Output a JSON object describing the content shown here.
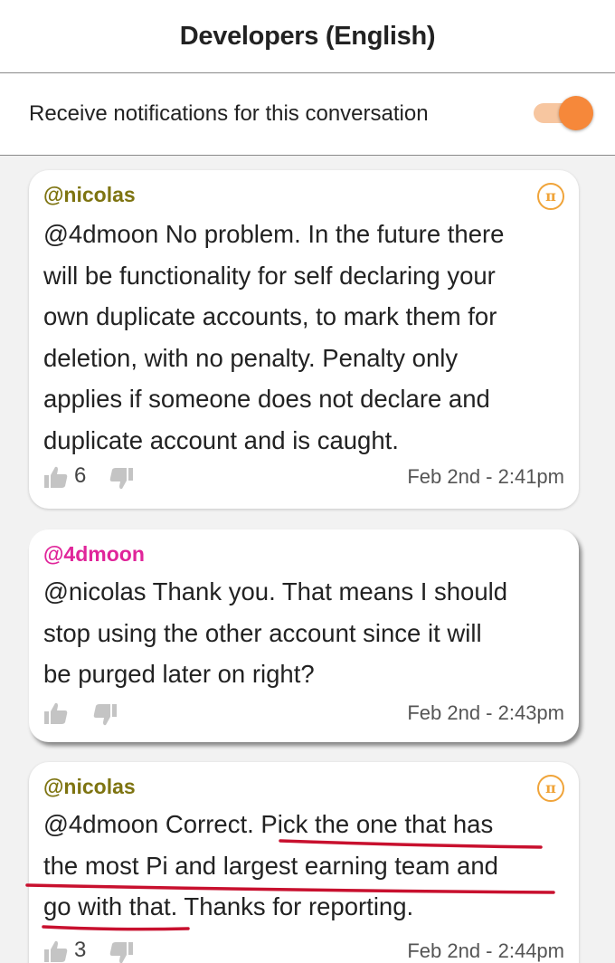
{
  "header": {
    "title": "Developers (English)"
  },
  "notifications": {
    "label": "Receive notifications for this conversation",
    "enabled": true,
    "accent": "#f6883a"
  },
  "messages": [
    {
      "author": "@nicolas",
      "badge": "π",
      "lines": [
        "@4dmoon No problem. In the future there",
        "will be functionality for self declaring your",
        "own duplicate accounts, to mark them for",
        "deletion, with no penalty. Penalty only",
        "applies if someone does not declare and",
        "duplicate account and is caught."
      ],
      "likes": "6",
      "timestamp": "Feb 2nd - 2:41pm"
    },
    {
      "author": "@4dmoon",
      "lines": [
        "@nicolas Thank you. That means I should",
        "stop using the other account since it will",
        "be purged later on right?"
      ],
      "likes": "",
      "timestamp": "Feb 2nd - 2:43pm"
    },
    {
      "author": "@nicolas",
      "badge": "π",
      "lines": [
        "@4dmoon Correct. Pick the one that has",
        "the most Pi and largest earning team and",
        "go with that. Thanks for reporting."
      ],
      "likes": "3",
      "timestamp": "Feb 2nd - 2:44pm"
    }
  ],
  "colors": {
    "nicolas": "#7e7411",
    "moon": "#e0259a",
    "pi_badge": "#f0a43a",
    "annotation": "#c8102e"
  }
}
